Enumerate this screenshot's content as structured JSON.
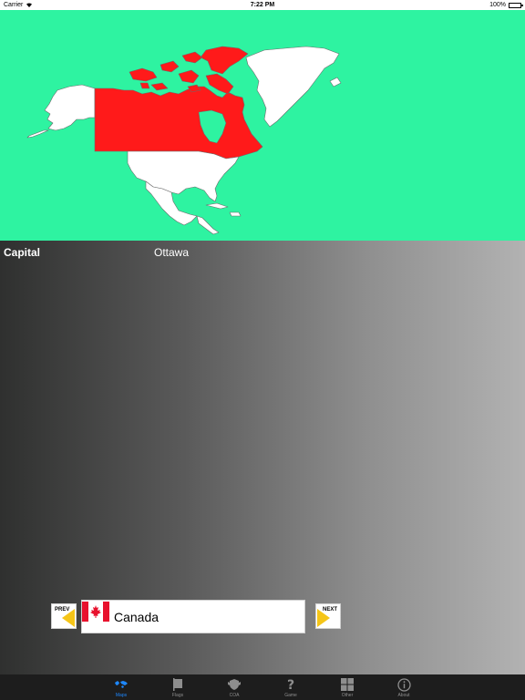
{
  "status_bar": {
    "carrier": "Carrier",
    "time": "7:22 PM",
    "battery": "100%",
    "battery_level": 1.0
  },
  "map": {
    "background_color": "#2ef3a1",
    "highlight_color": "#ff1a1a",
    "land_color": "#ffffff"
  },
  "info": {
    "label": "Capital",
    "value": "Ottawa"
  },
  "navigation": {
    "prev_label": "PREV",
    "next_label": "NEXT",
    "arrow_color": "#f5c518"
  },
  "country": {
    "name": "Canada",
    "flag_icon": "canada-flag-icon"
  },
  "tabs": [
    {
      "label": "Maps",
      "icon": "world-map-icon",
      "active": true
    },
    {
      "label": "Flags",
      "icon": "flag-icon",
      "active": false
    },
    {
      "label": "COA",
      "icon": "coat-of-arms-icon",
      "active": false
    },
    {
      "label": "Game",
      "icon": "question-mark-icon",
      "active": false
    },
    {
      "label": "Other",
      "icon": "grid-icon",
      "active": false
    },
    {
      "label": "About",
      "icon": "info-icon",
      "active": false
    }
  ],
  "tab_colors": {
    "active": "#1e88ff",
    "inactive": "#8e8e8e"
  }
}
